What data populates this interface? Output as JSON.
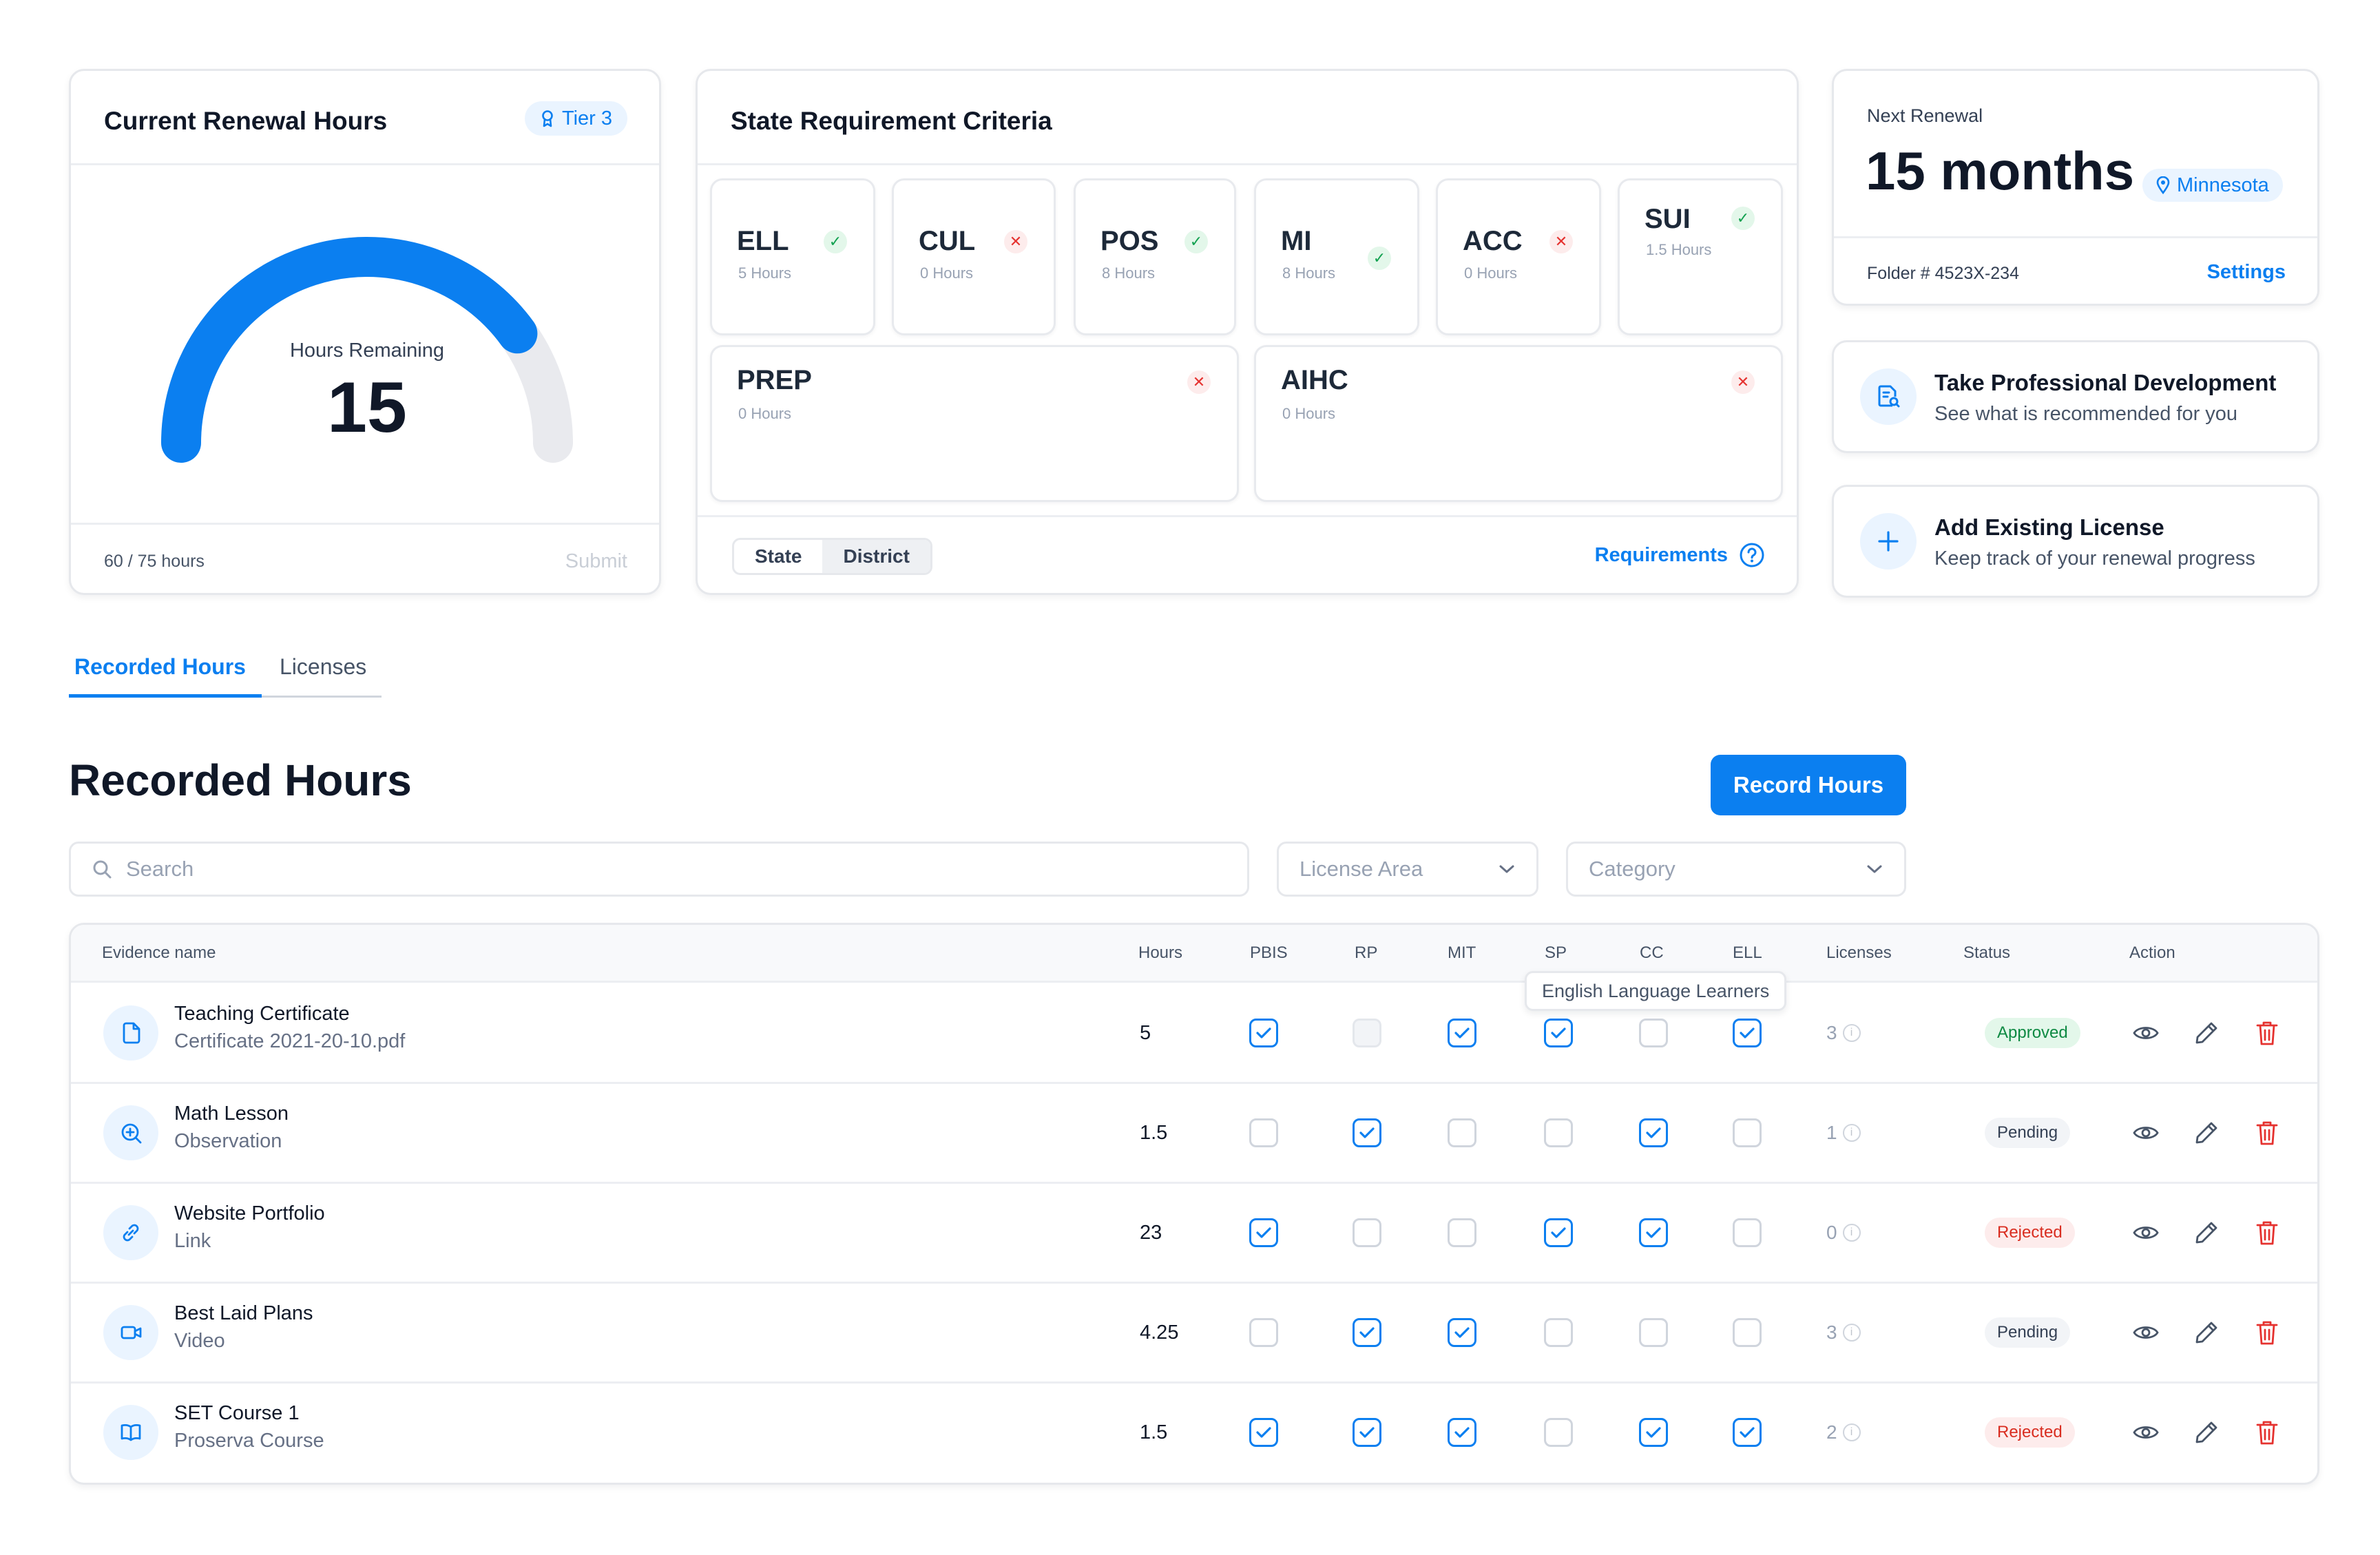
{
  "renewal": {
    "title": "Current Renewal Hours",
    "tier": "Tier 3",
    "gauge_label": "Hours Remaining",
    "gauge_value": "15",
    "gauge_fraction": 0.8,
    "progress_text": "60 / 75 hours",
    "submit_label": "Submit"
  },
  "criteria": {
    "title": "State Requirement Criteria",
    "items": [
      {
        "code": "ELL",
        "hours": "5 Hours",
        "met": true
      },
      {
        "code": "CUL",
        "hours": "0 Hours",
        "met": false
      },
      {
        "code": "POS",
        "hours": "8 Hours",
        "met": true
      },
      {
        "code": "MI",
        "hours": "8 Hours",
        "met": true
      },
      {
        "code": "ACC",
        "hours": "0 Hours",
        "met": false
      },
      {
        "code": "SUI",
        "hours": "1.5 Hours",
        "met": true
      },
      {
        "code": "PREP",
        "hours": "0 Hours",
        "met": false
      },
      {
        "code": "AIHC",
        "hours": "0 Hours",
        "met": false
      }
    ],
    "toggle": {
      "state": "State",
      "district": "District",
      "selected": "District"
    },
    "requirements_link": "Requirements"
  },
  "next_renewal": {
    "label": "Next Renewal",
    "value": "15 months",
    "location": "Minnesota",
    "folder": "Folder # 4523X-234",
    "settings_label": "Settings"
  },
  "actions": {
    "pd": {
      "title": "Take Professional Development",
      "subtitle": "See what is recommended for you"
    },
    "license": {
      "title": "Add Existing License",
      "subtitle": "Keep track of your renewal progress"
    }
  },
  "tabs": {
    "recorded": "Recorded Hours",
    "licenses": "Licenses",
    "active": "Recorded Hours"
  },
  "section": {
    "title": "Recorded Hours",
    "record_button": "Record Hours"
  },
  "filters": {
    "search_placeholder": "Search",
    "license_area_placeholder": "License Area",
    "category_placeholder": "Category"
  },
  "table": {
    "headers": {
      "evidence": "Evidence name",
      "hours": "Hours",
      "pbis": "PBIS",
      "rp": "RP",
      "mit": "MIT",
      "sp": "SP",
      "cc": "CC",
      "ell": "ELL",
      "licenses": "Licenses",
      "status": "Status",
      "action": "Action"
    },
    "tooltip": "English Language Learners",
    "rows": [
      {
        "title": "Teaching Certificate",
        "sub": "Certificate 2021-20-10.pdf",
        "icon": "file-icon",
        "hours": "5",
        "checks": [
          true,
          null,
          true,
          true,
          false,
          true
        ],
        "licenses": "3",
        "status": "Approved"
      },
      {
        "title": "Math Lesson",
        "sub": "Observation",
        "icon": "zoom-in-icon",
        "hours": "1.5",
        "checks": [
          false,
          true,
          false,
          false,
          true,
          false
        ],
        "licenses": "1",
        "status": "Pending"
      },
      {
        "title": "Website Portfolio",
        "sub": "Link",
        "icon": "link-icon",
        "hours": "23",
        "checks": [
          true,
          false,
          false,
          true,
          true,
          false
        ],
        "licenses": "0",
        "status": "Rejected"
      },
      {
        "title": "Best Laid Plans",
        "sub": "Video",
        "icon": "video-icon",
        "hours": "4.25",
        "checks": [
          false,
          true,
          true,
          false,
          false,
          false
        ],
        "licenses": "3",
        "status": "Pending"
      },
      {
        "title": "SET Course 1",
        "sub": "Proserva Course",
        "icon": "book-icon",
        "hours": "1.5",
        "checks": [
          true,
          true,
          true,
          false,
          true,
          true
        ],
        "licenses": "2",
        "status": "Rejected"
      }
    ]
  },
  "colors": {
    "accent": "#0b7ff0",
    "success": "#12a150",
    "danger": "#e5322f"
  }
}
